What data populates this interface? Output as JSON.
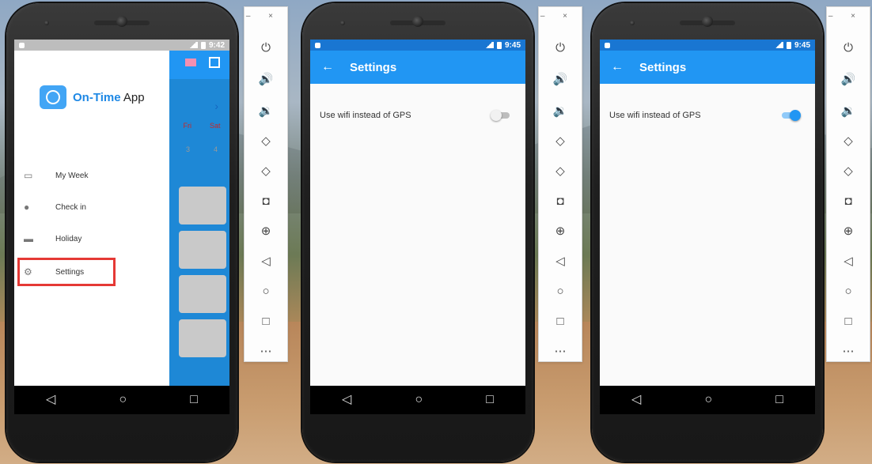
{
  "phone1": {
    "time": "9:42",
    "app_name": "On-Time",
    "app_suffix": " App",
    "calendar_days": [
      "Fri",
      "Sat"
    ],
    "calendar_nums": [
      "3",
      "4"
    ],
    "menu": [
      {
        "label": "My Week",
        "icon": "calendar-icon"
      },
      {
        "label": "Check in",
        "icon": "location-pin-icon"
      },
      {
        "label": "Holiday",
        "icon": "bed-icon"
      },
      {
        "label": "Settings",
        "icon": "gear-icon"
      }
    ],
    "highlight_color": "#e53935"
  },
  "phone2": {
    "time": "9:45",
    "title": "Settings",
    "setting_label": "Use wifi instead of GPS",
    "toggle_state": "off"
  },
  "phone3": {
    "time": "9:45",
    "title": "Settings",
    "setting_label": "Use wifi instead of GPS",
    "toggle_state": "on"
  },
  "toolbar": {
    "window_controls": "– ×",
    "tools": [
      "power-icon",
      "volume-up-icon",
      "volume-down-icon",
      "rotate-left-icon",
      "rotate-right-icon",
      "camera-icon",
      "zoom-icon",
      "back-icon",
      "home-icon",
      "overview-icon",
      "more-icon"
    ]
  },
  "colors": {
    "appbar": "#2196f3",
    "toggle_on": "#2196f3"
  }
}
